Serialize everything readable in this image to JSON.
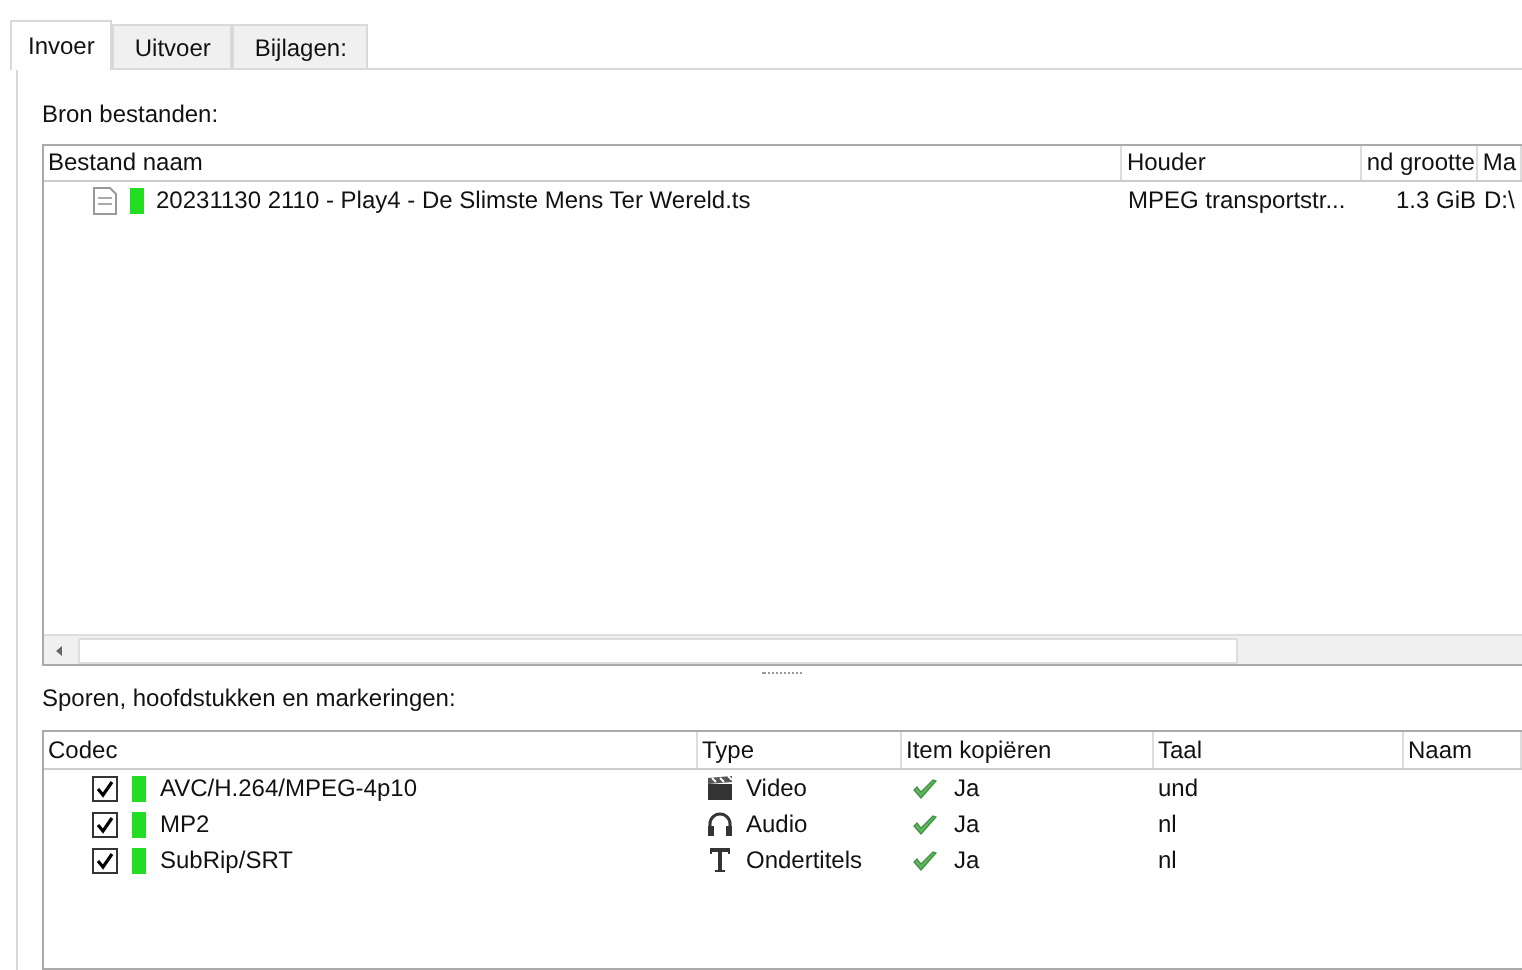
{
  "tabs": [
    {
      "label": "Invoer",
      "selected": true
    },
    {
      "label": "Uitvoer",
      "selected": false
    },
    {
      "label": "Bijlagen:",
      "selected": false
    }
  ],
  "source_files": {
    "label": "Bron bestanden:",
    "columns": [
      "Bestand naam",
      "Houder",
      "nd grootte",
      "Ma"
    ],
    "rows": [
      {
        "color": "#22dd22",
        "name": "20231130 2110 - Play4 - De Slimste Mens Ter Wereld.ts",
        "container": "MPEG transportstr...",
        "size": "1.3 GiB",
        "path": "D:\\"
      }
    ]
  },
  "tracks": {
    "label": "Sporen, hoofdstukken en markeringen:",
    "columns": [
      "Codec",
      "Type",
      "Item kopiëren",
      "Taal",
      "Naam"
    ],
    "rows": [
      {
        "checked": true,
        "color": "#22dd22",
        "codec": "AVC/H.264/MPEG-4p10",
        "kind": "video",
        "type": "Video",
        "copy": "Ja",
        "language": "und"
      },
      {
        "checked": true,
        "color": "#22dd22",
        "codec": "MP2",
        "kind": "audio",
        "type": "Audio",
        "copy": "Ja",
        "language": "nl"
      },
      {
        "checked": true,
        "color": "#22dd22",
        "codec": "SubRip/SRT",
        "kind": "subtitles",
        "type": "Ondertitels",
        "copy": "Ja",
        "language": "nl"
      }
    ]
  }
}
